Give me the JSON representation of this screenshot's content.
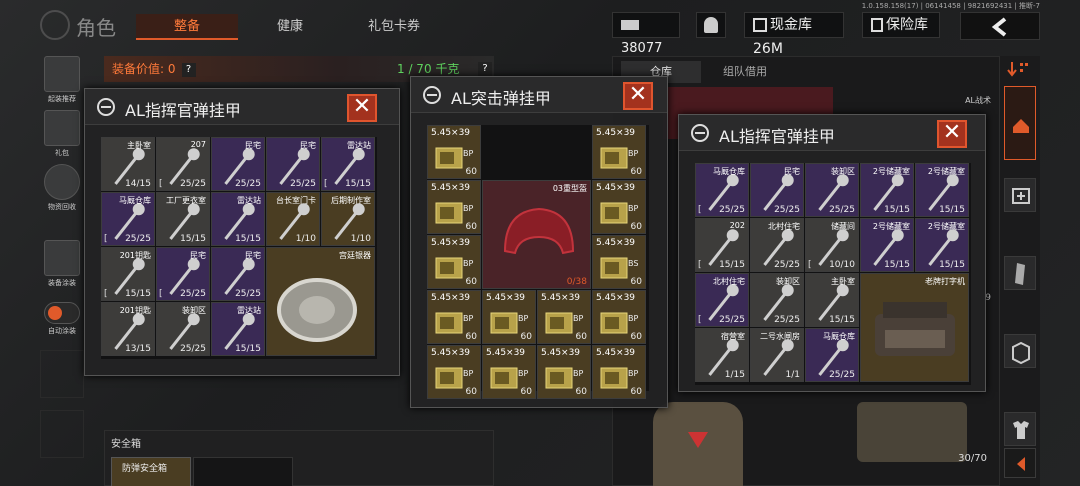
{
  "top": {
    "role": "角色",
    "tabs": [
      "整备",
      "健康",
      "礼包卡券"
    ],
    "active_tab": "整备",
    "version": "1.0.158.158(17) | 06141458 | 9821692431 | 推断-7",
    "currency": "38077",
    "cash": "现金库 26M",
    "safe": "保险库"
  },
  "left_rail": [
    "起装推荐",
    "礼包",
    "物资回收",
    "装备涂装",
    "自动涂装"
  ],
  "equip": {
    "value_label": "装备价值: 0",
    "capacity": "1 / 70 千克",
    "safe_box": "安全箱",
    "safe_box_item": "防弹安全箱"
  },
  "warehouse": {
    "tabs": [
      "仓库",
      "组队借用"
    ],
    "side_label": "AL战术",
    "count": "30/70",
    "n9": "9"
  },
  "popup1": {
    "title": "AL指挥官弹挂甲",
    "cells": [
      {
        "name": "主卧室",
        "count": "14/15",
        "c": "g"
      },
      {
        "name": "207",
        "count": "25/25",
        "c": "g",
        "br": "["
      },
      {
        "name": "民宅",
        "count": "25/25",
        "c": "p"
      },
      {
        "name": "民宅",
        "count": "25/25",
        "c": "p"
      },
      {
        "name": "雷达站",
        "count": "15/15",
        "c": "p",
        "br": "["
      },
      {
        "name": "马厩仓库",
        "count": "25/25",
        "c": "p",
        "br": "["
      },
      {
        "name": "工厂更衣室",
        "count": "15/15",
        "c": "g"
      },
      {
        "name": "雷达站",
        "count": "15/15",
        "c": "p"
      },
      {
        "name": "台长室门卡",
        "count": "1/10",
        "c": "y"
      },
      {
        "name": "后期制作室",
        "count": "1/10",
        "c": "y"
      },
      {
        "name": "201钥匙",
        "count": "15/15",
        "c": "g",
        "br": "["
      },
      {
        "name": "民宅",
        "count": "25/25",
        "c": "p",
        "br": "["
      },
      {
        "name": "民宅",
        "count": "25/25",
        "c": "p"
      },
      {
        "name": "宫廷银器",
        "count": "",
        "c": "y"
      },
      {
        "name": "201钥匙",
        "count": "13/15",
        "c": "g"
      },
      {
        "name": "装卸区",
        "count": "25/25",
        "c": "g"
      },
      {
        "name": "雷达站",
        "count": "15/15",
        "c": "p"
      }
    ]
  },
  "popup2": {
    "title": "AL突击弹挂甲",
    "helmet": "03重型盔",
    "helmet_dur": "0/38",
    "ammo_name": "5.45×39",
    "ammo_tag": "BP",
    "ammo_count": "60",
    "ammo_tag2": "BS"
  },
  "popup3": {
    "title": "AL指挥官弹挂甲",
    "cells": [
      {
        "name": "马厩仓库",
        "count": "25/25",
        "c": "p",
        "br": "["
      },
      {
        "name": "民宅",
        "count": "25/25",
        "c": "p"
      },
      {
        "name": "装卸区",
        "count": "25/25",
        "c": "p"
      },
      {
        "name": "2号储藏室",
        "count": "15/15",
        "c": "p"
      },
      {
        "name": "2号储藏室",
        "count": "15/15",
        "c": "p"
      },
      {
        "name": "202",
        "count": "15/15",
        "c": "g",
        "br": "["
      },
      {
        "name": "北村住宅",
        "count": "25/25",
        "c": "g"
      },
      {
        "name": "储藏间",
        "count": "10/10",
        "c": "g",
        "br": "["
      },
      {
        "name": "2号储藏室",
        "count": "15/15",
        "c": "p"
      },
      {
        "name": "2号储藏室",
        "count": "15/15",
        "c": "p"
      },
      {
        "name": "北村住宅",
        "count": "25/25",
        "c": "p",
        "br": "["
      },
      {
        "name": "装卸区",
        "count": "25/25",
        "c": "g"
      },
      {
        "name": "主卧室",
        "count": "15/15",
        "c": "g"
      },
      {
        "name": "老牌打字机",
        "count": "",
        "c": "y"
      },
      {
        "name": "宿营室",
        "count": "1/15",
        "c": "g"
      },
      {
        "name": "二号水闸房",
        "count": "1/1",
        "c": "g"
      },
      {
        "name": "马厩仓库",
        "count": "25/25",
        "c": "p"
      }
    ]
  },
  "colors": {
    "accent": "#e05a2a",
    "close": "#a3321e",
    "green": "#5fd35f",
    "orange": "#ff7a3a"
  }
}
